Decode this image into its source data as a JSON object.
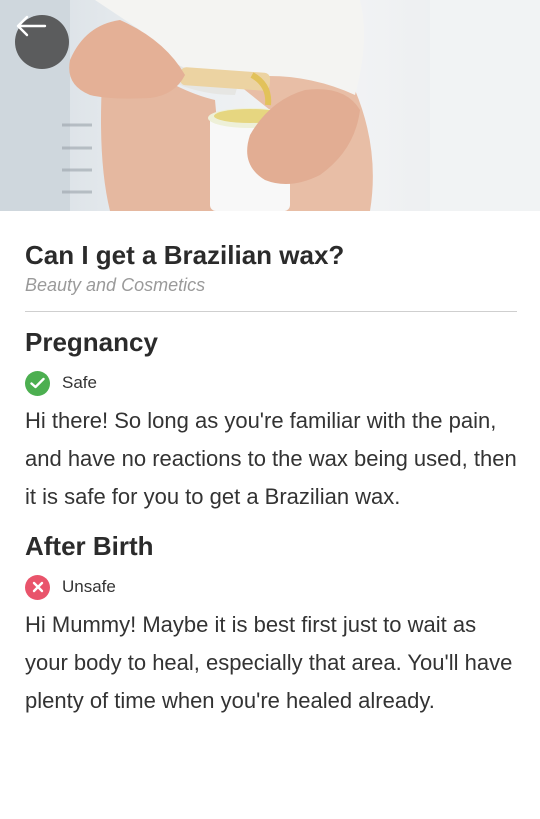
{
  "header": {
    "back_icon": "arrow-left-icon",
    "hero_image": "photo of hands holding a waxing spatula over a wax jar"
  },
  "article": {
    "title": "Can I get a Brazilian wax?",
    "category": "Beauty and Cosmetics"
  },
  "sections": [
    {
      "heading": "Pregnancy",
      "status": "Safe",
      "status_icon": "checkmark-icon",
      "status_color": "#4caf50",
      "text": "Hi there! So long as you're familiar with the pain, and have no reactions to the wax being used, then it is safe for you to get a Brazilian wax."
    },
    {
      "heading": "After Birth",
      "status": "Unsafe",
      "status_icon": "cross-icon",
      "status_color": "#e9546b",
      "text": "Hi Mummy! Maybe it is best first just to wait as your body to heal, especially that area. You'll have plenty of time when you're healed already."
    }
  ]
}
